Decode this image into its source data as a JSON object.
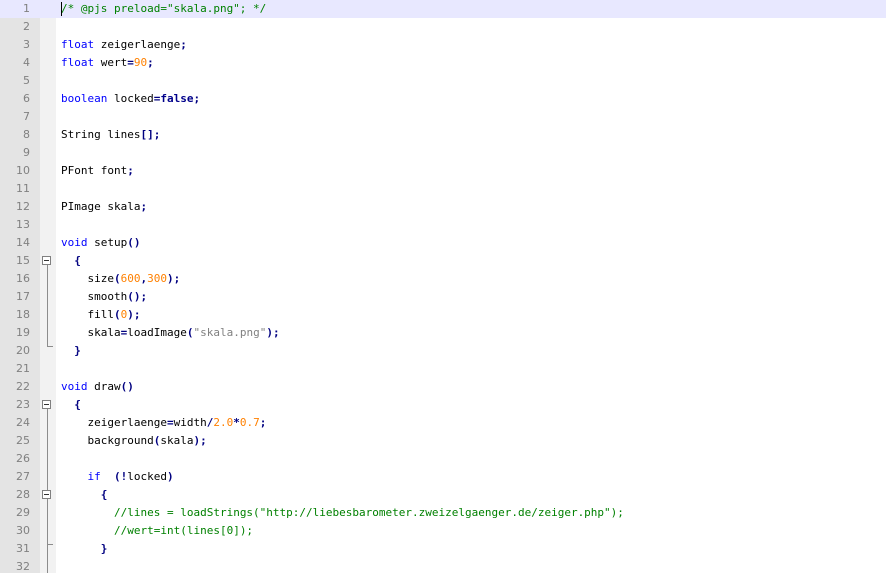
{
  "lines": [
    {
      "n": "1",
      "hl": true,
      "t": [
        [
          "cmt",
          "/* @pjs preload=\"skala.png\"; */"
        ]
      ]
    },
    {
      "n": "2",
      "t": []
    },
    {
      "n": "3",
      "t": [
        [
          "kw",
          "float"
        ],
        [
          "",
          "zeigerlaenge"
        ],
        [
          "op",
          ";"
        ]
      ]
    },
    {
      "n": "4",
      "t": [
        [
          "kw",
          "float"
        ],
        [
          "",
          "wert"
        ],
        [
          "op",
          "="
        ],
        [
          "num",
          "90"
        ],
        [
          "op",
          ";"
        ]
      ]
    },
    {
      "n": "5",
      "t": []
    },
    {
      "n": "6",
      "t": [
        [
          "kw",
          "boolean"
        ],
        [
          "",
          "locked"
        ],
        [
          "op",
          "="
        ],
        [
          "kwb",
          "false"
        ],
        [
          "op",
          ";"
        ]
      ]
    },
    {
      "n": "7",
      "t": []
    },
    {
      "n": "8",
      "t": [
        [
          "",
          "String lines"
        ],
        [
          "op",
          "[];"
        ]
      ]
    },
    {
      "n": "9",
      "t": []
    },
    {
      "n": "10",
      "t": [
        [
          "",
          "PFont font"
        ],
        [
          "op",
          ";"
        ]
      ]
    },
    {
      "n": "11",
      "t": []
    },
    {
      "n": "12",
      "t": [
        [
          "",
          "PImage skala"
        ],
        [
          "op",
          ";"
        ]
      ]
    },
    {
      "n": "13",
      "t": []
    },
    {
      "n": "14",
      "t": [
        [
          "kw",
          "void"
        ],
        [
          "",
          "setup"
        ],
        [
          "op",
          "()"
        ]
      ]
    },
    {
      "n": "15",
      "t": [
        [
          "",
          "  "
        ],
        [
          "op",
          "{"
        ]
      ]
    },
    {
      "n": "16",
      "t": [
        [
          "",
          "    size"
        ],
        [
          "op",
          "("
        ],
        [
          "num",
          "600"
        ],
        [
          "op",
          ","
        ],
        [
          "num",
          "300"
        ],
        [
          "op",
          ");"
        ]
      ]
    },
    {
      "n": "17",
      "t": [
        [
          "",
          "    smooth"
        ],
        [
          "op",
          "();"
        ]
      ]
    },
    {
      "n": "18",
      "t": [
        [
          "",
          "    fill"
        ],
        [
          "op",
          "("
        ],
        [
          "num",
          "0"
        ],
        [
          "op",
          ");"
        ]
      ]
    },
    {
      "n": "19",
      "t": [
        [
          "",
          "    skala"
        ],
        [
          "op",
          "="
        ],
        [
          "",
          "loadImage"
        ],
        [
          "op",
          "("
        ],
        [
          "str",
          "\"skala.png\""
        ],
        [
          "op",
          ");"
        ]
      ]
    },
    {
      "n": "20",
      "t": [
        [
          "",
          "  "
        ],
        [
          "op",
          "}"
        ]
      ]
    },
    {
      "n": "21",
      "t": []
    },
    {
      "n": "22",
      "t": [
        [
          "kw",
          "void"
        ],
        [
          "",
          "draw"
        ],
        [
          "op",
          "()"
        ]
      ]
    },
    {
      "n": "23",
      "t": [
        [
          "",
          "  "
        ],
        [
          "op",
          "{"
        ]
      ]
    },
    {
      "n": "24",
      "t": [
        [
          "",
          "    zeigerlaenge"
        ],
        [
          "op",
          "="
        ],
        [
          "",
          "width"
        ],
        [
          "op",
          "/"
        ],
        [
          "num",
          "2.0"
        ],
        [
          "op",
          "*"
        ],
        [
          "num",
          "0.7"
        ],
        [
          "op",
          ";"
        ]
      ]
    },
    {
      "n": "25",
      "t": [
        [
          "",
          "    background"
        ],
        [
          "op",
          "("
        ],
        [
          "",
          "skala"
        ],
        [
          "op",
          ");"
        ]
      ]
    },
    {
      "n": "26",
      "t": []
    },
    {
      "n": "27",
      "t": [
        [
          "",
          "    "
        ],
        [
          "kw",
          "if"
        ],
        [
          "",
          "  "
        ],
        [
          "op",
          "(!"
        ],
        [
          "",
          "locked"
        ],
        [
          "op",
          ")"
        ]
      ]
    },
    {
      "n": "28",
      "t": [
        [
          "",
          "      "
        ],
        [
          "op",
          "{"
        ]
      ]
    },
    {
      "n": "29",
      "t": [
        [
          "",
          "        "
        ],
        [
          "cmt",
          "//lines = loadStrings(\"http://liebesbarometer.zweizelgaenger.de/zeiger.php\");"
        ]
      ]
    },
    {
      "n": "30",
      "t": [
        [
          "",
          "        "
        ],
        [
          "cmt",
          "//wert=int(lines[0]);"
        ]
      ]
    },
    {
      "n": "31",
      "t": [
        [
          "",
          "      "
        ],
        [
          "op",
          "}"
        ]
      ]
    },
    {
      "n": "32",
      "t": []
    }
  ]
}
